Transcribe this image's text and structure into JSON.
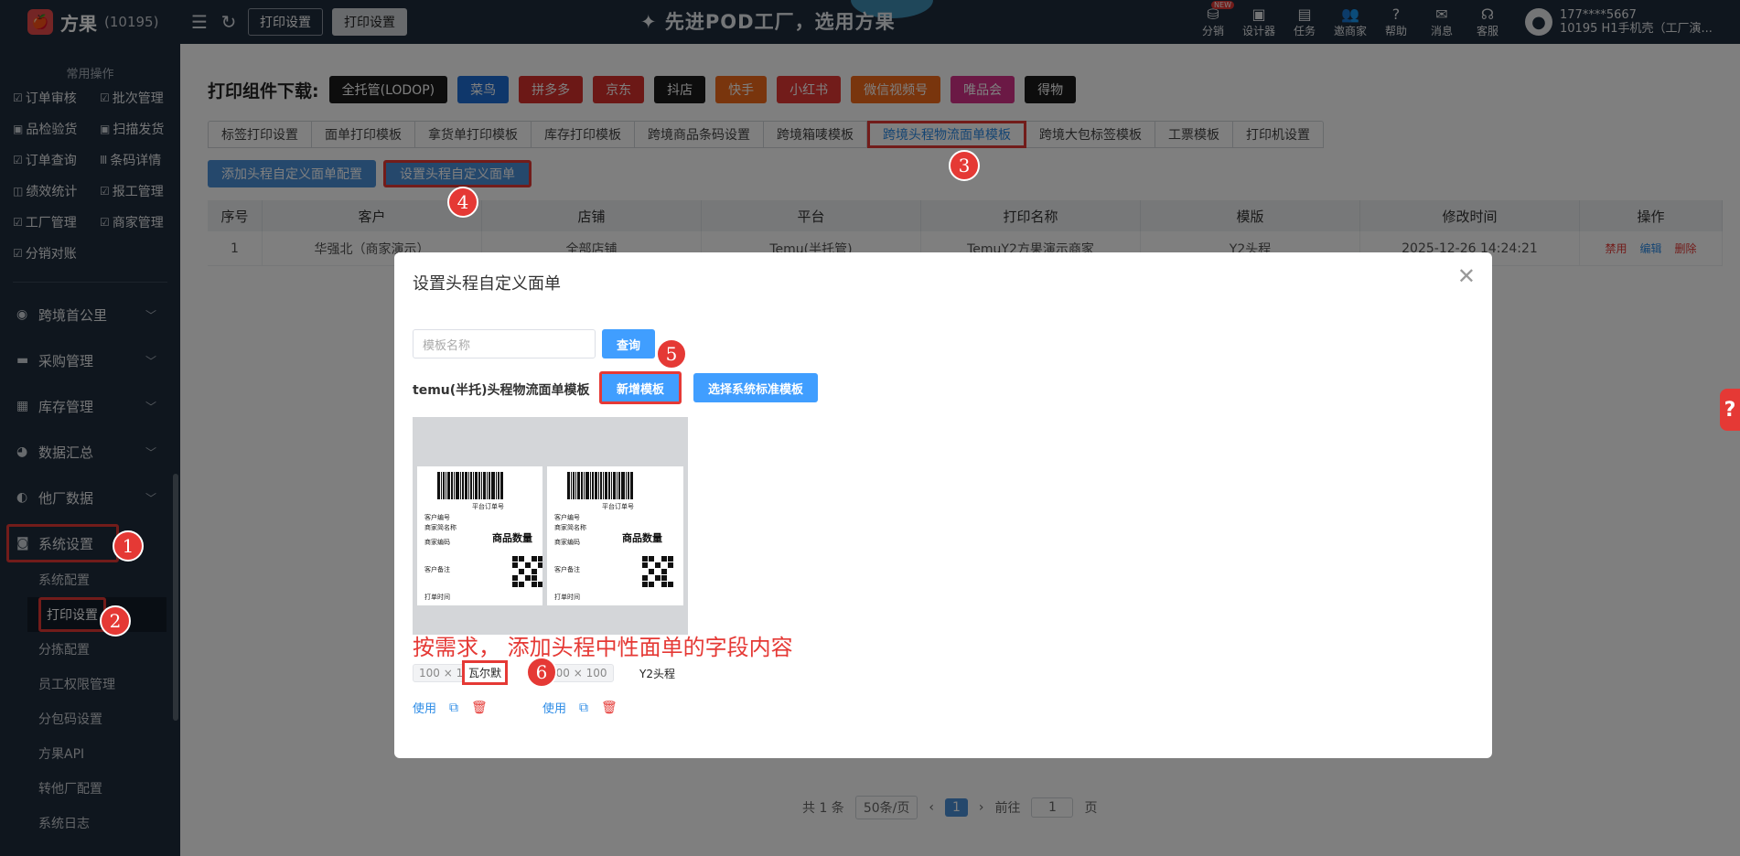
{
  "brand": {
    "name": "方果",
    "id": "(10195)",
    "logo_icon": "🍎"
  },
  "top_tabs": [
    "打印设置",
    "打印设置"
  ],
  "slogan": "✦ 先进POD工厂，选用方果",
  "top_items": [
    {
      "icon": "⛁",
      "label": "分销",
      "badge": "NEW"
    },
    {
      "icon": "▣",
      "label": "设计器"
    },
    {
      "icon": "▤",
      "label": "任务"
    },
    {
      "icon": "👥",
      "label": "邀商家"
    },
    {
      "icon": "?",
      "label": "帮助"
    },
    {
      "icon": "✉",
      "label": "消息"
    },
    {
      "icon": "☊",
      "label": "客服"
    }
  ],
  "user": {
    "line1": "177****5667",
    "line2": "10195 H1手机壳（工厂演..."
  },
  "sidebar": {
    "quick_title": "常用操作",
    "quick_items": [
      "订单审核",
      "批次管理",
      "品检验货",
      "扫描发货",
      "订单查询",
      "条码详情",
      "绩效统计",
      "报工管理",
      "工厂管理",
      "商家管理",
      "分销对账"
    ],
    "menus": [
      "跨境首公里",
      "采购管理",
      "库存管理",
      "数据汇总",
      "他厂数据"
    ],
    "system_menu": "系统设置",
    "sub_items": [
      "系统配置",
      "打印设置",
      "分拣配置",
      "员工权限管理",
      "分包码设置",
      "方果API",
      "转他厂配置",
      "系统日志"
    ]
  },
  "download": {
    "title": "打印组件下载:",
    "buttons": [
      {
        "label": "全托管(LODOP)",
        "color": "#1a1a1a"
      },
      {
        "label": "菜鸟",
        "color": "#1f6fd6"
      },
      {
        "label": "拼多多",
        "color": "#d9302c"
      },
      {
        "label": "京东",
        "color": "#d9302c"
      },
      {
        "label": "抖店",
        "color": "#1a1a1a"
      },
      {
        "label": "快手",
        "color": "#f26a1b"
      },
      {
        "label": "小红书",
        "color": "#e53935"
      },
      {
        "label": "微信视频号",
        "color": "#f26a1b"
      },
      {
        "label": "唯品会",
        "color": "#d6338a"
      },
      {
        "label": "得物",
        "color": "#1a1a1a"
      }
    ]
  },
  "tabs": [
    "标签打印设置",
    "面单打印模板",
    "拿货单打印模板",
    "库存打印模板",
    "跨境商品条码设置",
    "跨境箱唛模板",
    "跨境头程物流面单模板",
    "跨境大包标签模板",
    "工票模板",
    "打印机设置"
  ],
  "active_tab": 6,
  "actions": {
    "add": "添加头程自定义面单配置",
    "set": "设置头程自定义面单"
  },
  "table": {
    "headers": [
      "序号",
      "客户",
      "店铺",
      "平台",
      "打印名称",
      "模版",
      "修改时间",
      "操作"
    ],
    "row": [
      "1",
      "华强北（商家演示）",
      "全部店铺",
      "Temu(半托管)",
      "TemuY2方果演示商家",
      "Y2头程",
      "2025-12-26 14:24:21"
    ],
    "ops": [
      "禁用",
      "编辑",
      "删除"
    ]
  },
  "pager": {
    "total": "共 1 条",
    "per_page": "50条/页",
    "page": "1",
    "goto": "前往",
    "goto_val": "1",
    "page_unit": "页"
  },
  "modal": {
    "title": "设置头程自定义面单",
    "placeholder": "模板名称",
    "query": "查询",
    "label": "temu(半托)头程物流面单模板",
    "new_btn": "新增模板",
    "std_btn": "选择系统标准模板",
    "cards": [
      {
        "size": "100 × 100",
        "name": "瓦尔默"
      },
      {
        "size": "100 × 100",
        "name": "Y2头程"
      }
    ],
    "card_use": "使用",
    "annotation": "按需求， 添加头程中性面单的字段内容",
    "label_texts": {
      "order_no": "平台订单号",
      "shop": "商家简名称",
      "qty": "商品数量",
      "sub1": "客户编号",
      "sub2": "商家编码",
      "sub3": "客户备注",
      "sub4": "打单时间"
    }
  },
  "badges": [
    "1",
    "2",
    "3",
    "4",
    "5",
    "6"
  ],
  "help": "?"
}
